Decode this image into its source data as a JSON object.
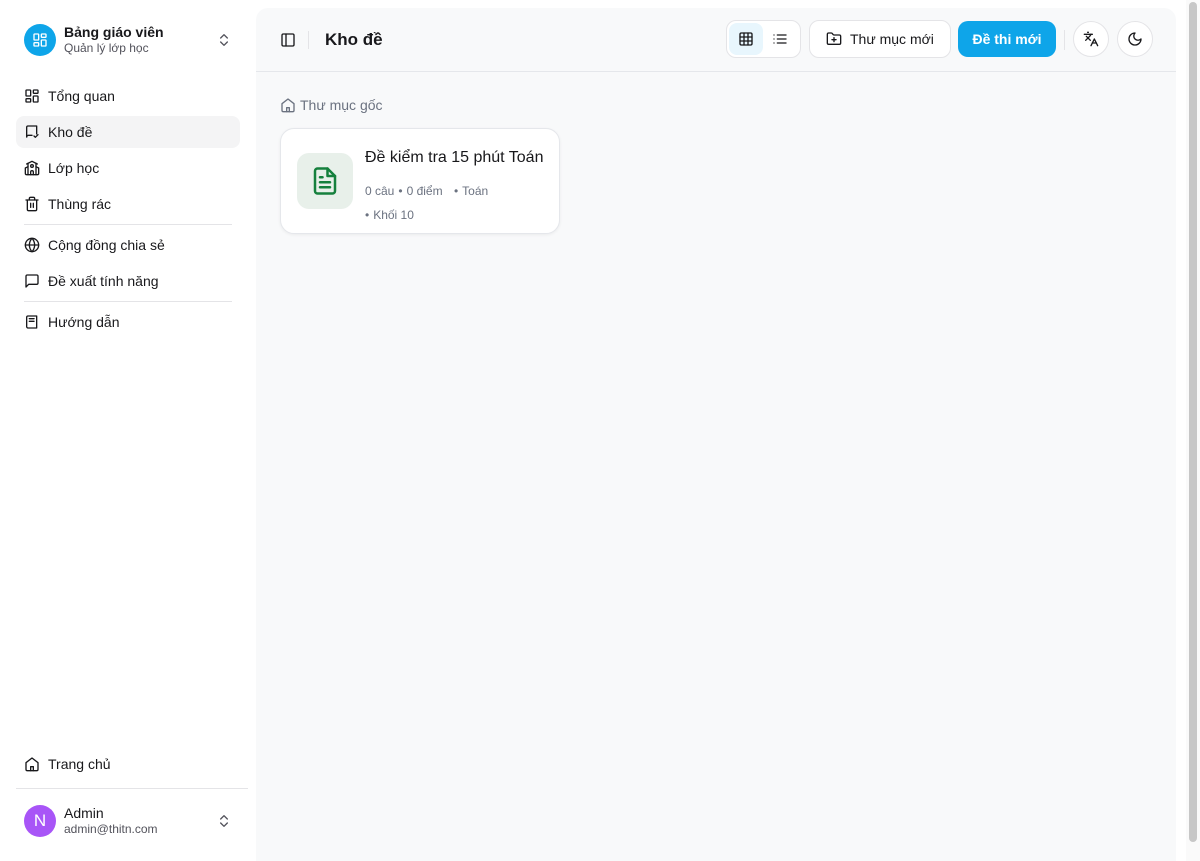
{
  "team": {
    "name": "Bảng giáo viên",
    "subtitle": "Quản lý lớp học"
  },
  "nav": {
    "items": [
      {
        "label": "Tổng quan"
      },
      {
        "label": "Kho đề",
        "active": true
      },
      {
        "label": "Lớp học"
      },
      {
        "label": "Thùng rác"
      }
    ],
    "community": [
      {
        "label": "Cộng đồng chia sẻ"
      },
      {
        "label": "Đề xuất tính năng"
      }
    ],
    "guide": {
      "label": "Hướng dẫn"
    },
    "home": {
      "label": "Trang chủ"
    }
  },
  "user": {
    "initial": "N",
    "name": "Admin",
    "email": "admin@thitn.com"
  },
  "header": {
    "title": "Kho đề",
    "view_mode": "grid",
    "new_folder_label": "Thư mục mới",
    "new_exam_label": "Đề thi mới"
  },
  "breadcrumb": {
    "root_label": "Thư mục gốc"
  },
  "exams": [
    {
      "title": "Đề kiểm tra 15 phút Toán",
      "questions": "0 câu",
      "points": "0 điểm",
      "subject": "Toán",
      "grade": "Khối 10"
    }
  ],
  "colors": {
    "accent": "#0ea5e9",
    "avatar": "#a855f7",
    "doc_icon": "#15803d",
    "main_bg": "#f8f9fa"
  }
}
